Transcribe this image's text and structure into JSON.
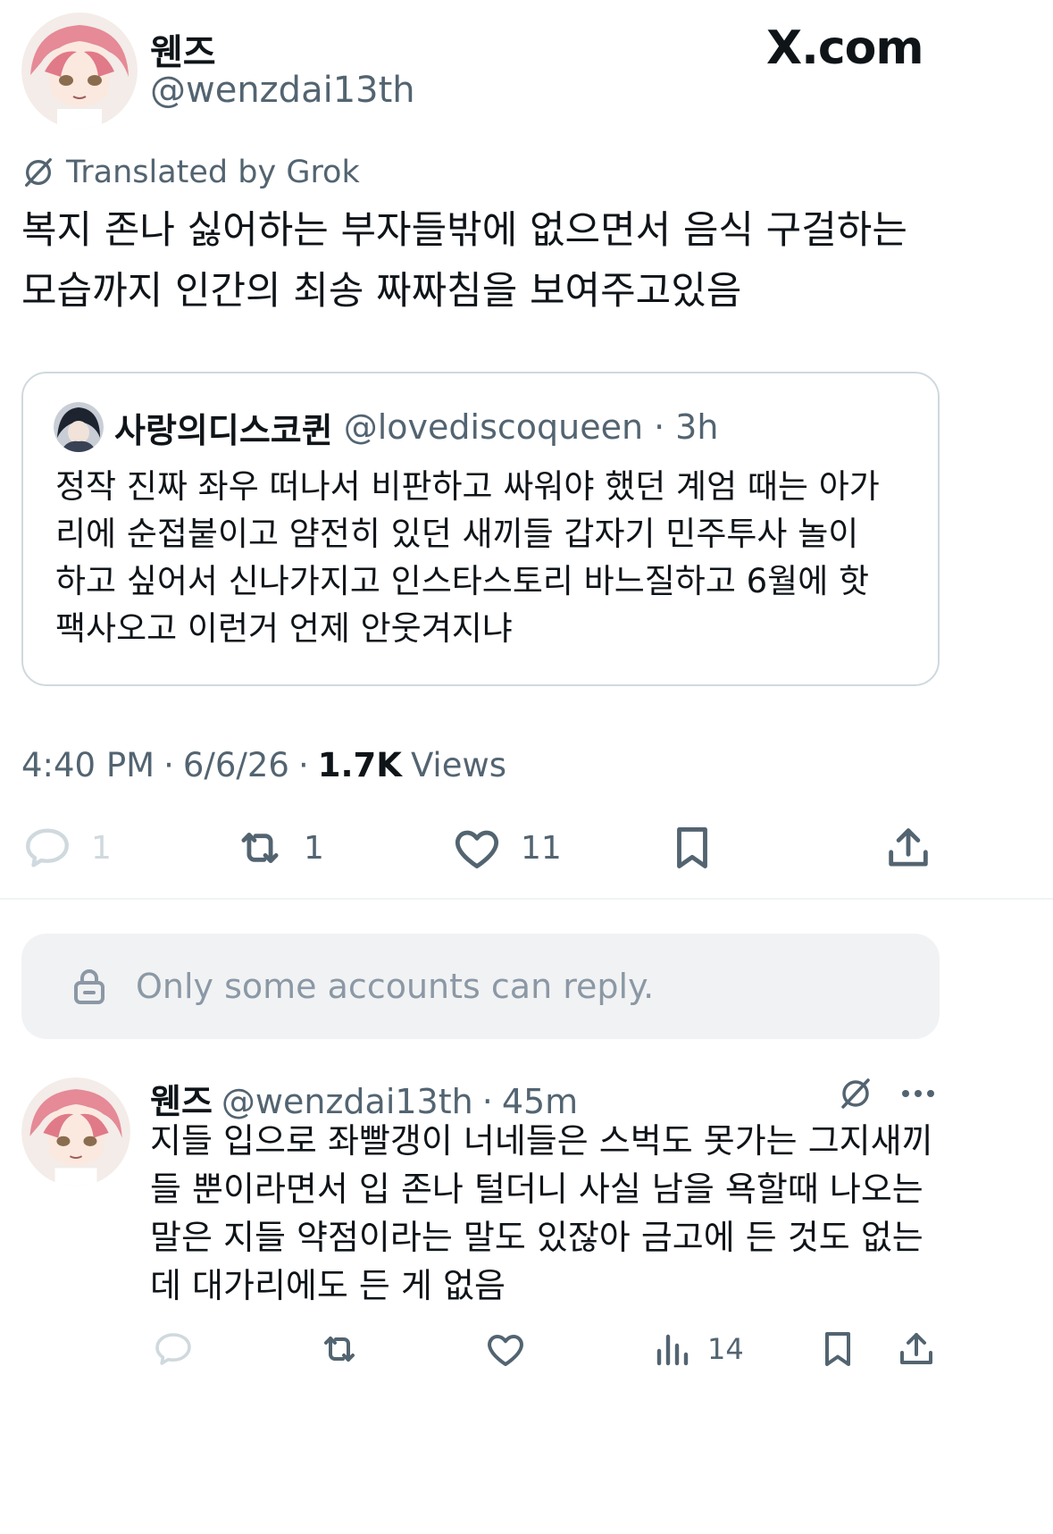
{
  "site_logo": "X.com",
  "author": {
    "display_name": "웬즈",
    "handle": "@wenzdai13th"
  },
  "translation_note": "Translated by Grok",
  "tweet_text": "복지 존나 싫어하는 부자들밖에 없으면서 음식 구걸하는\n모습까지 인간의 최송 짜짜침을 보여주고있음",
  "quote": {
    "display_name": "사랑의디스코퀸",
    "handle": "@lovediscoqueen",
    "separator": "·",
    "time": "3h",
    "text": "정작 진짜 좌우 떠나서 비판하고 싸워야 했던 계엄 때는 아가\n리에 순접붙이고 얌전히 있던 새끼들 갑자기 민주투사 놀이\n하고 싶어서 신나가지고 인스타스토리 바느질하고 6월에 핫\n팩사오고 이런거 언제 안웃겨지냐"
  },
  "meta": {
    "time": "4:40 PM",
    "sep1": "·",
    "date": "6/6/26",
    "sep2": "·",
    "views_count": "1.7K",
    "views_label": "Views"
  },
  "actions": {
    "reply_count": "1",
    "repost_count": "1",
    "like_count": "11"
  },
  "reply_restriction": "Only some accounts can reply.",
  "reply": {
    "display_name": "웬즈",
    "handle": "@wenzdai13th",
    "separator": "·",
    "time": "45m",
    "text": "지들 입으로 좌빨갱이 너네들은 스벅도 못가는 그지새끼\n들 뿐이라면서 입 존나 털더니 사실 남을 욕할때 나오는\n말은 지들 약점이라는 말도 있잖아 금고에 든 것도 없는\n데 대가리에도 든 게 없음",
    "views_count": "14"
  },
  "colors": {
    "text": "#0f1419",
    "secondary": "#536471",
    "border": "#cfd9de",
    "restrict_bg": "#f1f2f3"
  }
}
